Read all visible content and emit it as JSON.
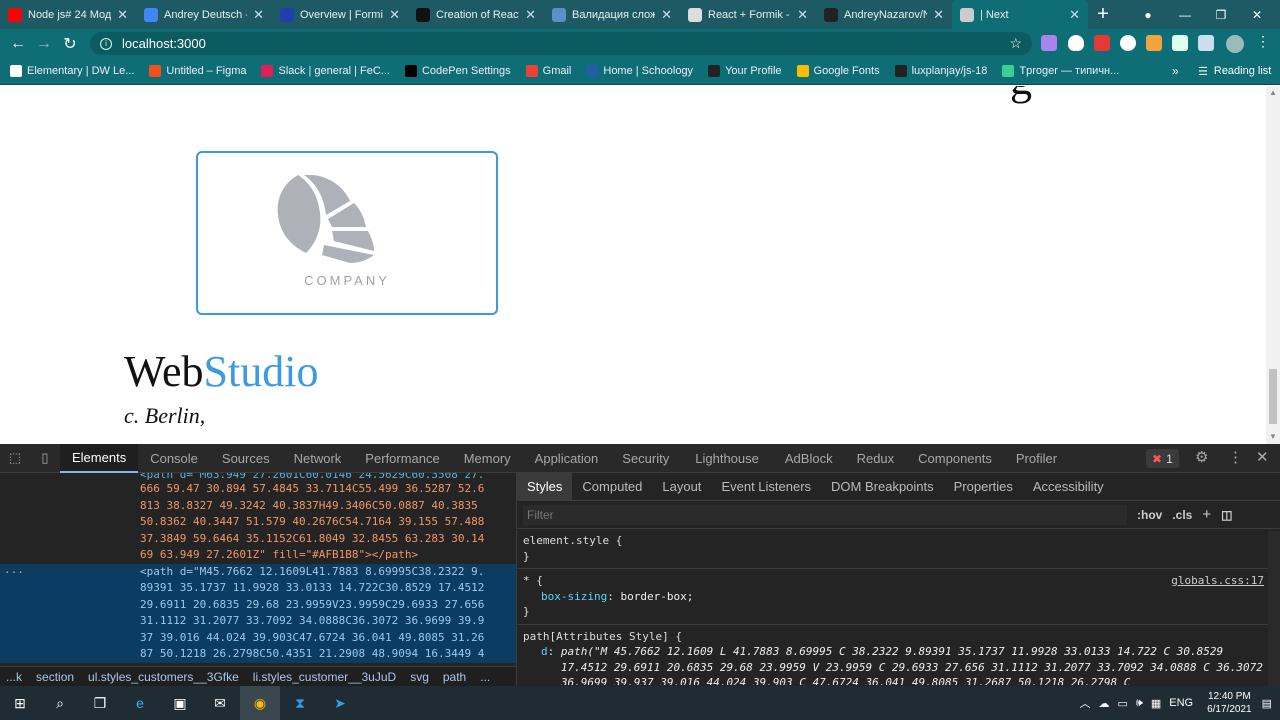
{
  "tabs": [
    {
      "title": "Node js# 24 Мод",
      "color": "#ff0000"
    },
    {
      "title": "Andrey Deutsch -",
      "color": "#4285f4"
    },
    {
      "title": "Overview | Formik",
      "color": "#1e40af"
    },
    {
      "title": "Creation of React",
      "color": "#111111"
    },
    {
      "title": "Валидация сложн",
      "color": "#5b8fc7"
    },
    {
      "title": "React + Formik -",
      "color": "#dddddd"
    },
    {
      "title": "AndreyNazarov/N",
      "color": "#222222"
    },
    {
      "title": "| Next",
      "color": "#cccccc"
    }
  ],
  "address": "localhost:3000",
  "bookmarks": [
    {
      "label": "Elementary | DW Le...",
      "color": "#ffffff"
    },
    {
      "label": "Untitled – Figma",
      "color": "#f24e1e"
    },
    {
      "label": "Slack | general | FeC...",
      "color": "#e01e5a"
    },
    {
      "label": "CodePen Settings",
      "color": "#000000"
    },
    {
      "label": "Gmail",
      "color": "#ea4335"
    },
    {
      "label": "Home | Schoology",
      "color": "#1f5fa6"
    },
    {
      "label": "Your Profile",
      "color": "#222222"
    },
    {
      "label": "Google Fonts",
      "color": "#fbbc04"
    },
    {
      "label": "luxplanjay/js-18",
      "color": "#222222"
    },
    {
      "label": "Tproger — типичн...",
      "color": "#3ccf91"
    }
  ],
  "reading_list": "Reading list",
  "page": {
    "company": "COMPANY",
    "brand_web": "Web",
    "brand_studio": "Studio",
    "address_line": "c. Berlin,"
  },
  "devtools": {
    "tabs": [
      "Elements",
      "Console",
      "Sources",
      "Network",
      "Performance",
      "Memory",
      "Application",
      "Security",
      "Lighthouse",
      "AdBlock",
      "Redux",
      "Components",
      "Profiler"
    ],
    "error_count": "1",
    "code_lines": [
      "666 59.47 30.894 57.4845 33.7114C55.499 36.5287 52.6",
      "813 38.8327 49.3242 40.3837H49.3406C50.0887 40.3835",
      "50.8362 40.3447 51.579 40.2676C54.7164 39.155 57.488",
      "37.3849 59.6464 35.1152C61.8049 32.8455 63.283 30.14",
      "69 63.949 27.2601Z\" fill=\"#AFB1B8\"></path>"
    ],
    "selected_lines": [
      "<path d=\"M45.7662 12.1609L41.7883 8.69995C38.2322 9.",
      "89391 35.1737 11.9928 33.0133 14.722C30.8529 17.4512",
      "29.6911 20.6835 29.68 23.9959V23.9959C29.6933 27.656",
      "31.1112 31.2077 33.7092 34.0888C36.3072 36.9699 39.9",
      "37 39.016 44.024 39.903C47.6724 36.041 49.8085 31.26",
      "87 50.1218 26.2798C50.4351 21.2908 48.9094 16.3449 4"
    ],
    "breadcrumbs": [
      "...k",
      "section",
      "ul.styles_customers__3Gfke",
      "li.styles_customer__3uJuD",
      "svg",
      "path",
      "..."
    ],
    "style_tabs": [
      "Styles",
      "Computed",
      "Layout",
      "Event Listeners",
      "DOM Breakpoints",
      "Properties",
      "Accessibility"
    ],
    "filter_placeholder": "Filter",
    "hov": ":hov",
    "cls": ".cls",
    "rules": {
      "element_style": "element.style {",
      "star_selector": "* {",
      "star_source": "globals.css:17",
      "box_sizing_prop": "box-sizing",
      "box_sizing_val": "border-box;",
      "path_selector": "path[Attributes Style] {",
      "d_prop": "d",
      "d_val": "path(\"M 45.7662 12.1609 L 41.7883 8.69995 C 38.2322 9.89391 35.1737 11.9928 33.0133 14.722 C 30.8529 17.4512 29.6911 20.6835 29.68 23.9959 V 23.9959 C 29.6933 27.656 31.1112 31.2077 33.7092 34.0888 C 36.3072 36.9699 39.937 39.016 44.024 39.903 C 47.6724 36.041 49.8085 31.2687 50.1218 26.2798 C"
    }
  },
  "taskbar": {
    "lang": "ENG",
    "time": "12:40 PM",
    "date": "6/17/2021"
  }
}
